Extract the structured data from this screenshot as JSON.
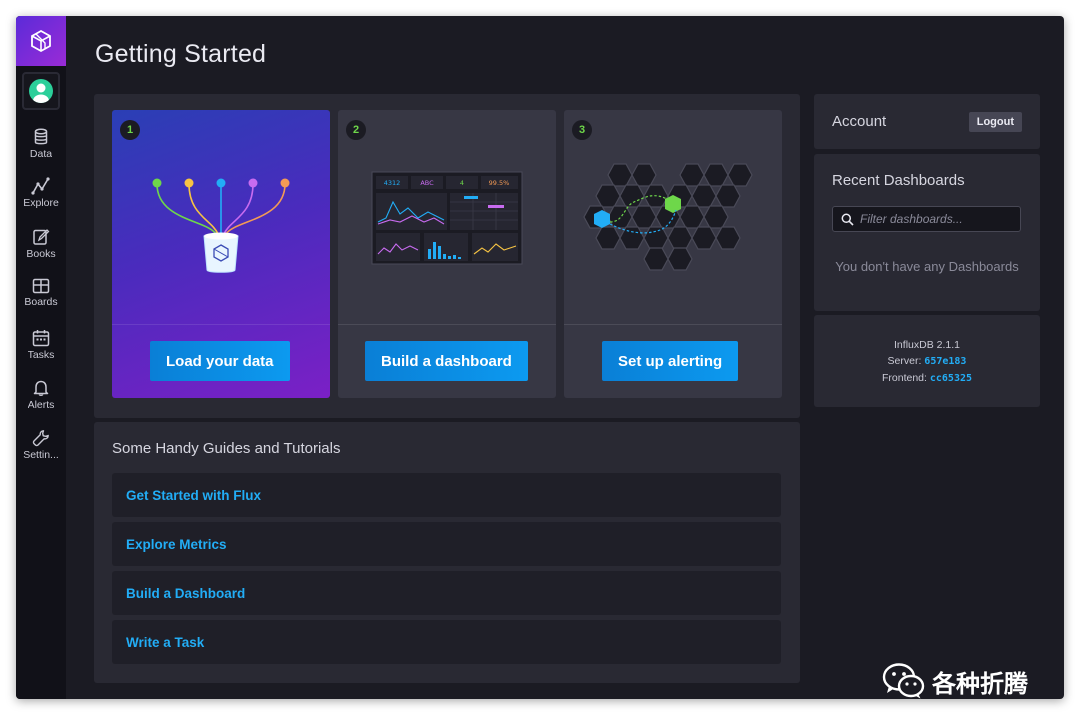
{
  "page": {
    "title": "Getting Started"
  },
  "sidebar": {
    "items": [
      {
        "label": "Data",
        "icon": "database-icon"
      },
      {
        "label": "Explore",
        "icon": "graph-icon"
      },
      {
        "label": "Books",
        "icon": "notebook-icon"
      },
      {
        "label": "Boards",
        "icon": "dashboard-icon"
      },
      {
        "label": "Tasks",
        "icon": "calendar-icon"
      },
      {
        "label": "Alerts",
        "icon": "bell-icon"
      },
      {
        "label": "Settin...",
        "icon": "wrench-icon"
      }
    ]
  },
  "steps": [
    {
      "number": "1",
      "button": "Load your data"
    },
    {
      "number": "2",
      "button": "Build a dashboard"
    },
    {
      "number": "3",
      "button": "Set up alerting"
    }
  ],
  "dashboard_illustration": {
    "cells": [
      "4312",
      "ABC",
      "4",
      "99.5%"
    ]
  },
  "guides": {
    "title": "Some Handy Guides and Tutorials",
    "items": [
      "Get Started with Flux",
      "Explore Metrics",
      "Build a Dashboard",
      "Write a Task"
    ]
  },
  "account": {
    "label": "Account",
    "logout": "Logout"
  },
  "recent_dashboards": {
    "title": "Recent Dashboards",
    "filter_placeholder": "Filter dashboards...",
    "empty_message": "You don't have any Dashboards"
  },
  "version": {
    "product": "InfluxDB 2.1.1",
    "server_label": "Server:",
    "server_value": "657e183",
    "frontend_label": "Frontend:",
    "frontend_value": "cc65325"
  },
  "watermark": {
    "text": "各种折腾"
  },
  "colors": {
    "accent": "#0b90e8",
    "link": "#22adf6",
    "step_number": "#6ed74a",
    "logo_gradient_start": "#5b2bd9",
    "logo_gradient_end": "#9a2bd6"
  }
}
